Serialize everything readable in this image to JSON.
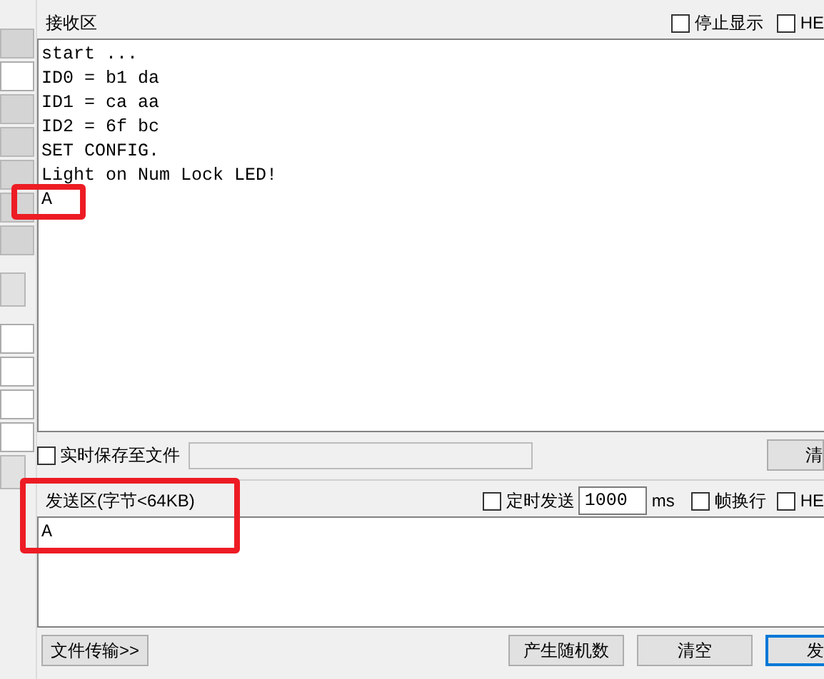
{
  "side_strip": [
    {
      "kind": "grey"
    },
    {
      "kind": "white"
    },
    {
      "kind": "grey"
    },
    {
      "kind": "grey"
    },
    {
      "kind": "grey"
    },
    {
      "kind": "grey"
    },
    {
      "kind": "grey"
    },
    {
      "kind": "gap"
    },
    {
      "kind": "button"
    },
    {
      "kind": "gap"
    },
    {
      "kind": "white"
    },
    {
      "kind": "white"
    },
    {
      "kind": "white"
    },
    {
      "kind": "white"
    },
    {
      "kind": "button"
    }
  ],
  "receive": {
    "title": "接收区",
    "options": [
      {
        "label": "停止显示",
        "checked": false
      },
      {
        "label": "HE",
        "checked": false
      }
    ],
    "lines": [
      "start ...",
      "ID0 = b1 da",
      "ID1 = ca aa",
      "ID2 = 6f bc",
      "SET CONFIG.",
      "Light on Num Lock LED!",
      "A"
    ],
    "save": {
      "label": "实时保存至文件",
      "checked": false
    },
    "clear_button": "清"
  },
  "send": {
    "title": "发送区(字节<64KB)",
    "timed": {
      "label": "定时发送",
      "checked": false
    },
    "interval": "1000",
    "unit": "ms",
    "options": [
      {
        "label": "帧换行",
        "checked": false
      },
      {
        "label": "HE",
        "checked": false
      }
    ],
    "text": "A",
    "buttons": [
      {
        "label": "文件传输>>",
        "kind": "left"
      },
      {
        "label": "产生随机数",
        "kind": "right"
      },
      {
        "label": "清空",
        "kind": "right"
      },
      {
        "label": "发",
        "kind": "default"
      }
    ]
  },
  "annotations": [
    {
      "kind": "rectangle"
    },
    {
      "kind": "rectangle"
    }
  ]
}
